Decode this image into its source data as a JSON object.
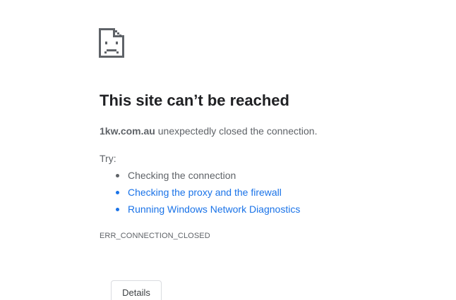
{
  "error": {
    "icon": "sad-document-icon",
    "title": "This site can’t be reached",
    "host": "1kw.com.au",
    "summary_rest": " unexpectedly closed the connection.",
    "try_label": "Try:",
    "suggestions": [
      {
        "label": "Checking the connection",
        "is_link": false
      },
      {
        "label": "Checking the proxy and the firewall",
        "is_link": true
      },
      {
        "label": "Running Windows Network Diagnostics",
        "is_link": true
      }
    ],
    "code": "ERR_CONNECTION_CLOSED",
    "details_button": "Details"
  },
  "colors": {
    "title": "#202124",
    "body_text": "#5f6368",
    "link": "#1a73e8",
    "button_border": "#dadce0"
  }
}
